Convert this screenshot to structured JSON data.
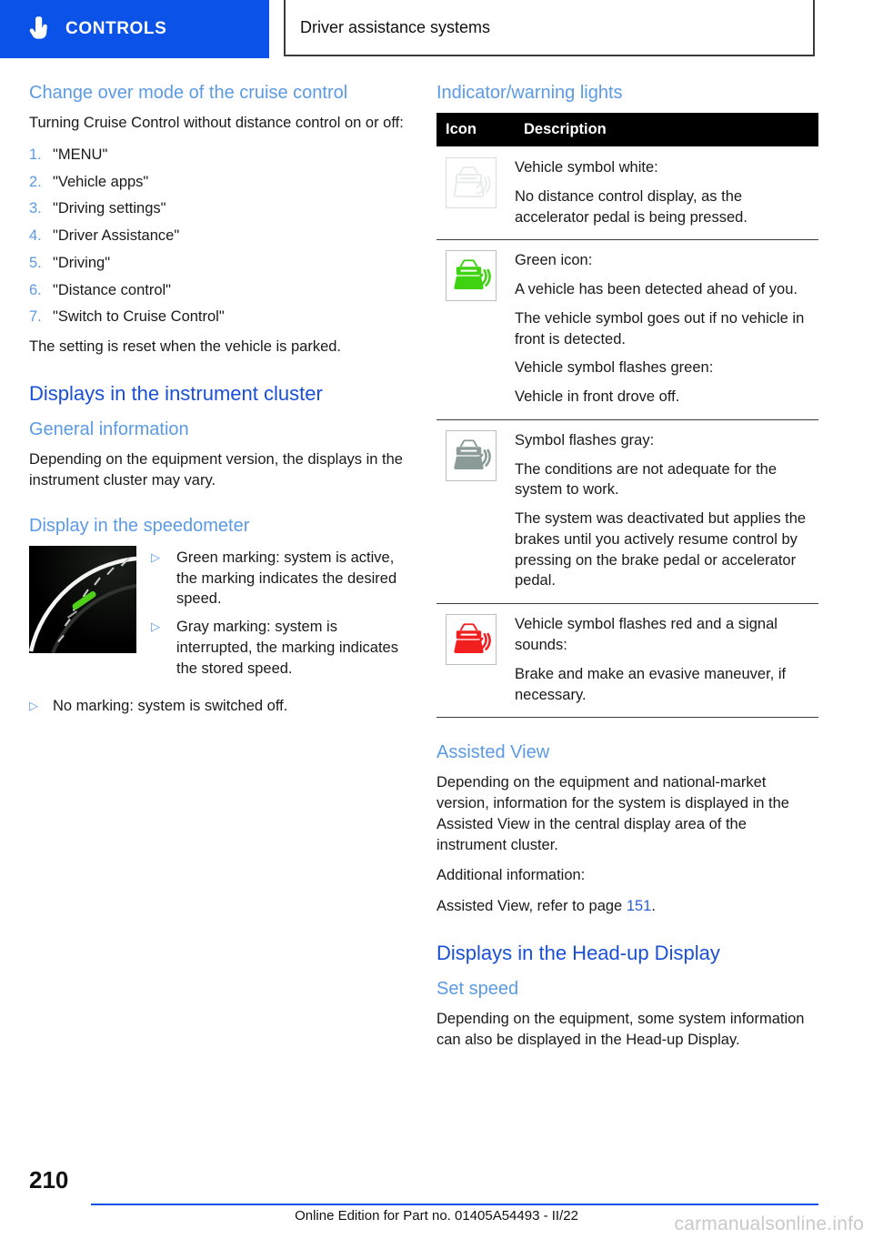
{
  "header": {
    "tab_label": "CONTROLS",
    "tab_icon": "pointing-hand-icon",
    "section_title": "Driver assistance systems",
    "tab_bg_color": "#0a52e8"
  },
  "colors": {
    "heading_primary": "#1a4fd6",
    "heading_secondary": "#5b9ae4",
    "accent": "#0a52e8",
    "icon_green": "#3fd211",
    "icon_gray": "#8b9b97",
    "icon_red": "#f21f21",
    "icon_white": "#f2f4f4"
  },
  "left_column": {
    "heading_change_over": "Change over mode of the cruise control",
    "intro_paragraph": "Turning Cruise Control without distance control on or off:",
    "steps": [
      {
        "num": "1.",
        "text": "\"MENU\""
      },
      {
        "num": "2.",
        "text": "\"Vehicle apps\""
      },
      {
        "num": "3.",
        "text": "\"Driving settings\""
      },
      {
        "num": "4.",
        "text": "\"Driver Assistance\""
      },
      {
        "num": "5.",
        "text": "\"Driving\""
      },
      {
        "num": "6.",
        "text": "\"Distance control\""
      },
      {
        "num": "7.",
        "text": "\"Switch to Cruise Control\""
      }
    ],
    "after_steps_paragraph": "The setting is reset when the vehicle is parked.",
    "heading_displays_cluster": "Displays in the instrument cluster",
    "heading_general_information": "General information",
    "general_information_text": "Depending on the equipment version, the displays in the instrument cluster may vary.",
    "heading_display_speedometer": "Display in the speedometer",
    "speedometer_figure_alt": "speedometer-marking-figure",
    "speedometer_bullets": [
      "Green marking: system is active, the marking indicates the desired speed.",
      "Gray marking: system is interrupted, the marking indicates the stored speed."
    ],
    "speedometer_bullet_outer": "No marking: system is switched off."
  },
  "right_column": {
    "heading_indicator_warning": "Indicator/warning lights",
    "table": {
      "columns": [
        "Icon",
        "Description"
      ],
      "rows": [
        {
          "icon": "vehicle-white-icon",
          "icon_color": "#f2f4f4",
          "paragraphs": [
            "Vehicle symbol white:",
            "No distance control display, as the accelerator pedal is being pressed."
          ]
        },
        {
          "icon": "vehicle-green-icon",
          "icon_color": "#3fd211",
          "paragraphs": [
            "Green icon:",
            "A vehicle has been detected ahead of you.",
            "The vehicle symbol goes out if no vehicle in front is detected.",
            "Vehicle symbol flashes green:",
            "Vehicle in front drove off."
          ]
        },
        {
          "icon": "vehicle-gray-icon",
          "icon_color": "#8b9b97",
          "paragraphs": [
            "Symbol flashes gray:",
            "The conditions are not adequate for the system to work.",
            "The system was deactivated but applies the brakes until you actively resume control by pressing on the brake pedal or accelerator pedal."
          ]
        },
        {
          "icon": "vehicle-red-icon",
          "icon_color": "#f21f21",
          "paragraphs": [
            "Vehicle symbol flashes red and a signal sounds:",
            "Brake and make an evasive maneuver, if necessary."
          ]
        }
      ]
    },
    "heading_assisted_view": "Assisted View",
    "assisted_view_text": "Depending on the equipment and national-market version, information for the system is displayed in the Assisted View in the central display area of the instrument cluster.",
    "additional_information_label": "Additional information:",
    "assisted_view_ref_prefix": "Assisted View, refer to page ",
    "assisted_view_ref_page": "151",
    "assisted_view_ref_suffix": ".",
    "heading_head_up_display": "Displays in the Head-up Display",
    "heading_set_speed": "Set speed",
    "set_speed_text": "Depending on the equipment, some system information can also be displayed in the Head-up Display."
  },
  "footer": {
    "page_number": "210",
    "note": "Online Edition for Part no. 01405A54493 - II/22",
    "watermark": "carmanualsonline.info"
  }
}
